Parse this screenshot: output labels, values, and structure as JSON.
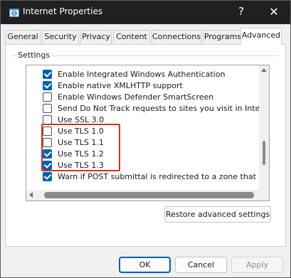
{
  "window": {
    "title": "Internet Properties",
    "help_glyph": "?",
    "close_glyph": "✕"
  },
  "tabs": [
    {
      "label": "General",
      "active": false
    },
    {
      "label": "Security",
      "active": false
    },
    {
      "label": "Privacy",
      "active": false
    },
    {
      "label": "Content",
      "active": false
    },
    {
      "label": "Connections",
      "active": false
    },
    {
      "label": "Programs",
      "active": false
    },
    {
      "label": "Advanced",
      "active": true
    }
  ],
  "settings": {
    "group_label": "Settings",
    "items": [
      {
        "label": "Enable Integrated Windows Authentication",
        "checked": true
      },
      {
        "label": "Enable native XMLHTTP support",
        "checked": true
      },
      {
        "label": "Enable Windows Defender SmartScreen",
        "checked": false
      },
      {
        "label": "Send Do Not Track requests to sites you visit in Internet E",
        "checked": false
      },
      {
        "label": "Use SSL 3.0",
        "checked": false
      },
      {
        "label": "Use TLS 1.0",
        "checked": false
      },
      {
        "label": "Use TLS 1.1",
        "checked": false
      },
      {
        "label": "Use TLS 1.2",
        "checked": true
      },
      {
        "label": "Use TLS 1.3",
        "checked": true
      },
      {
        "label": "Warn if POST submittal is redirected to a zone that does n",
        "checked": true
      }
    ],
    "restore_label": "Restore advanced settings"
  },
  "footer": {
    "ok_label": "OK",
    "cancel_label": "Cancel",
    "apply_label": "Apply"
  },
  "colors": {
    "accent": "#005fb8",
    "highlight": "#d6321e",
    "titlebar": "#202020"
  }
}
